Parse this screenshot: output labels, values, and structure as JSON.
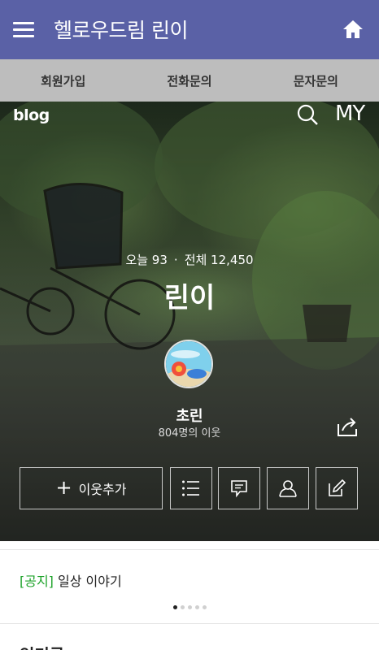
{
  "appbar": {
    "title": "헬로우드림 린이",
    "bg_color": "#5a61a6",
    "menu_icon": "hamburger-icon",
    "home_icon": "home-icon"
  },
  "subnav": {
    "tabs": [
      "회원가입",
      "전화문의",
      "문자문의"
    ],
    "bg_color": "#bdbdbd"
  },
  "blog": {
    "logo": "blog",
    "search_icon": "search-icon",
    "my_label": "MY",
    "today_label": "오늘 93",
    "dot": "·",
    "total_label": "전체 12,450",
    "title": "린이",
    "nickname": "초린",
    "neighbors": "804명의 이웃",
    "share_icon": "share-icon"
  },
  "actions": {
    "add_neighbor_label": "이웃추가",
    "icons": [
      "list-icon",
      "comment-icon",
      "neighbor-icon",
      "write-icon"
    ]
  },
  "notice": {
    "tag": "[공지]",
    "text": " 일상 이야기",
    "page_count": 5,
    "current_page": 1,
    "tag_color": "#1ea32a"
  },
  "section": {
    "title": "인기글"
  }
}
